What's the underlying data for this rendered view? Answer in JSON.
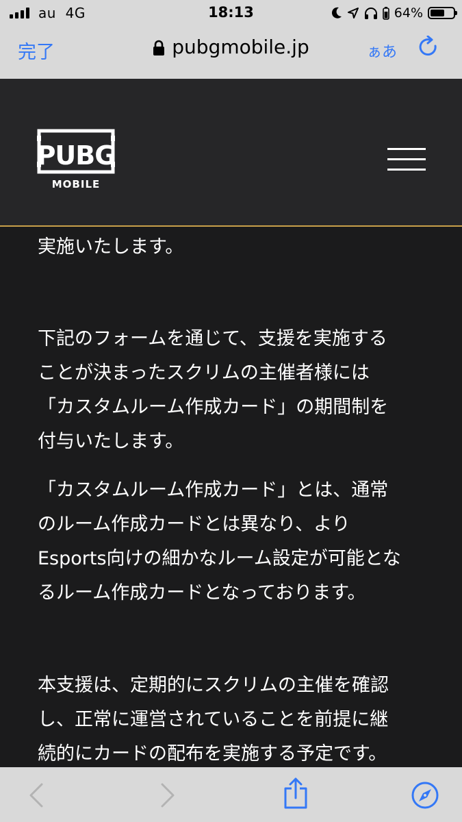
{
  "status_bar": {
    "carrier": "au",
    "network": "4G",
    "time": "18:13",
    "battery_percent": "64%",
    "battery_level": 0.64
  },
  "address_bar": {
    "done_label": "完了",
    "url": "pubgmobile.jp",
    "text_size_label": "ぁあ"
  },
  "header": {
    "logo_icon": "pubg-mobile-logo",
    "menu_icon": "hamburger-menu-icon"
  },
  "content": {
    "paragraphs": [
      {
        "lines": [
          "実施いたします。"
        ]
      },
      {
        "lines": [
          "下記のフォームを通じて、支援を実施する",
          "ことが決まったスクリムの主催者様には",
          "「カスタムルーム作成カード」の期間制を",
          "付与いたします。"
        ]
      },
      {
        "lines": [
          "「カスタムルーム作成カード」とは、通常",
          "のルーム作成カードとは異なり、より",
          "Esports向けの細かなルーム設定が可能とな",
          "るルーム作成カードとなっております。"
        ]
      },
      {
        "lines": [
          "本支援は、定期的にスクリムの主催を確認",
          "し、正常に運営されていることを前提に継",
          "続的にカードの配布を実施する予定です。"
        ]
      }
    ]
  },
  "colors": {
    "accent_blue": "#3478f6",
    "header_gold_line": "#c9a04a",
    "page_bg": "#1b1b1c",
    "header_bg": "#262628"
  }
}
